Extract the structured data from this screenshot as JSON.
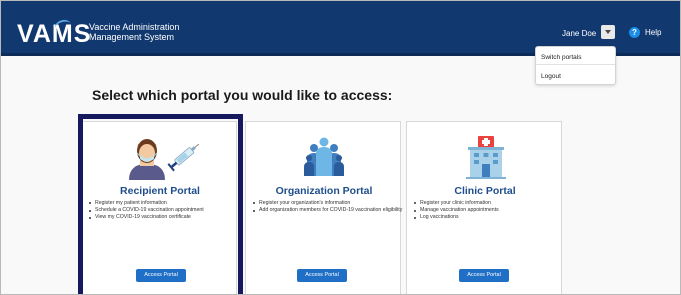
{
  "header": {
    "logo_text": "VAMS",
    "system_name_line1": "Vaccine Administration",
    "system_name_line2": "Management System",
    "user_name": "Jane Doe",
    "help_label": "Help"
  },
  "user_menu": {
    "items": [
      {
        "label": "Switch portals"
      },
      {
        "label": "Logout"
      }
    ]
  },
  "page": {
    "title": "Select which portal you would like to access:"
  },
  "portals": [
    {
      "title": "Recipient Portal",
      "icon": "recipient-vaccine-icon",
      "selected": true,
      "bullets": [
        "Register my patient information",
        "Schedule a COVID-19 vaccination appointment",
        "View my COVID-19 vaccination certificate"
      ],
      "button_label": "Access Portal"
    },
    {
      "title": "Organization Portal",
      "icon": "organization-people-icon",
      "selected": false,
      "bullets": [
        "Register your organization's information",
        "Add organization members for COVID-19 vaccination eligibility"
      ],
      "button_label": "Access Portal"
    },
    {
      "title": "Clinic Portal",
      "icon": "clinic-building-icon",
      "selected": false,
      "bullets": [
        "Register your clinic information",
        "Manage vaccination appointments",
        "Log vaccinations"
      ],
      "button_label": "Access Portal"
    }
  ],
  "colors": {
    "header_bg": "#11386f",
    "card_title": "#1f4e8c",
    "button_bg": "#1f6fc6",
    "selected_outline": "#15195e"
  }
}
